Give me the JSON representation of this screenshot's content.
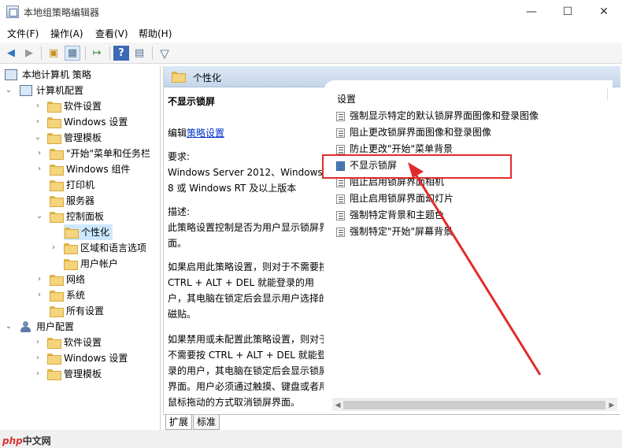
{
  "window": {
    "title": "本地组策略编辑器",
    "minimize_glyph": "—",
    "maximize_glyph": "☐",
    "close_glyph": "✕"
  },
  "menu": [
    {
      "label": "文件(F)"
    },
    {
      "label": "操作(A)"
    },
    {
      "label": "查看(V)"
    },
    {
      "label": "帮助(H)"
    }
  ],
  "toolbar": {
    "icons": [
      "back-icon",
      "forward-icon",
      "up-folder-icon",
      "show-hide-tree-icon",
      "export-list-icon",
      "help-icon",
      "properties-icon",
      "filter-icon"
    ],
    "back": "◀",
    "forward": "▶",
    "up": "▣",
    "tree": "▦",
    "export": "↦",
    "help": "?",
    "properties": "▤",
    "filter": "▽"
  },
  "tree": {
    "root": "本地计算机 策略",
    "computer_config": "计算机配置",
    "software_settings": "软件设置",
    "windows_settings": "Windows 设置",
    "admin_templates": "管理模板",
    "start_menu": "\"开始\"菜单和任务栏",
    "windows_components": "Windows 组件",
    "printers": "打印机",
    "servers": "服务器",
    "control_panel": "控制面板",
    "personalization": "个性化",
    "region_language": "区域和语言选项",
    "user_accounts": "用户帐户",
    "network": "网络",
    "system": "系统",
    "all_settings": "所有设置",
    "user_config": "用户配置",
    "user_software": "软件设置",
    "user_windows": "Windows 设置",
    "user_admin": "管理模板",
    "expanded_glyph": "⌄",
    "collapsed_glyph": "›"
  },
  "pane": {
    "title": "个性化"
  },
  "description": {
    "title": "不显示锁屏",
    "edit_prefix": "编辑",
    "edit_link": "策略设置",
    "requirements_label": "要求:",
    "requirements": "Windows Server 2012、Windows 8 或 Windows RT 及以上版本",
    "description_label": "描述:",
    "description": "此策略设置控制是否为用户显示锁屏界面。",
    "enabled": "如果启用此策略设置，则对于不需要按 CTRL + ALT + DEL 就能登录的用户，其电脑在锁定后会显示用户选择的磁贴。",
    "disabled": "如果禁用或未配置此策略设置，则对于不需要按 CTRL + ALT + DEL 就能登录的用户，其电脑在锁定后会显示锁屏界面。用户必须通过触摸、键盘或者用鼠标拖动的方式取消锁屏界面。"
  },
  "list": {
    "header": "设置",
    "items": [
      {
        "label": "强制显示特定的默认锁屏界面图像和登录图像"
      },
      {
        "label": "阻止更改锁屏界面图像和登录图像"
      },
      {
        "label": "防止更改\"开始\"菜单背景"
      },
      {
        "label": "不显示锁屏"
      },
      {
        "label": "阻止启用锁屏界面相机"
      },
      {
        "label": "阻止启用锁屏界面幻灯片"
      },
      {
        "label": "强制特定背景和主题色"
      },
      {
        "label": "强制特定\"开始\"屏幕背景"
      }
    ]
  },
  "tabs": {
    "expanded": "扩展",
    "standard": "标准"
  },
  "watermark": {
    "brand": "php",
    "text": "中文网"
  },
  "colors": {
    "highlight": "#e12b2b",
    "selection": "#cce8ff",
    "link": "#0033cc"
  }
}
